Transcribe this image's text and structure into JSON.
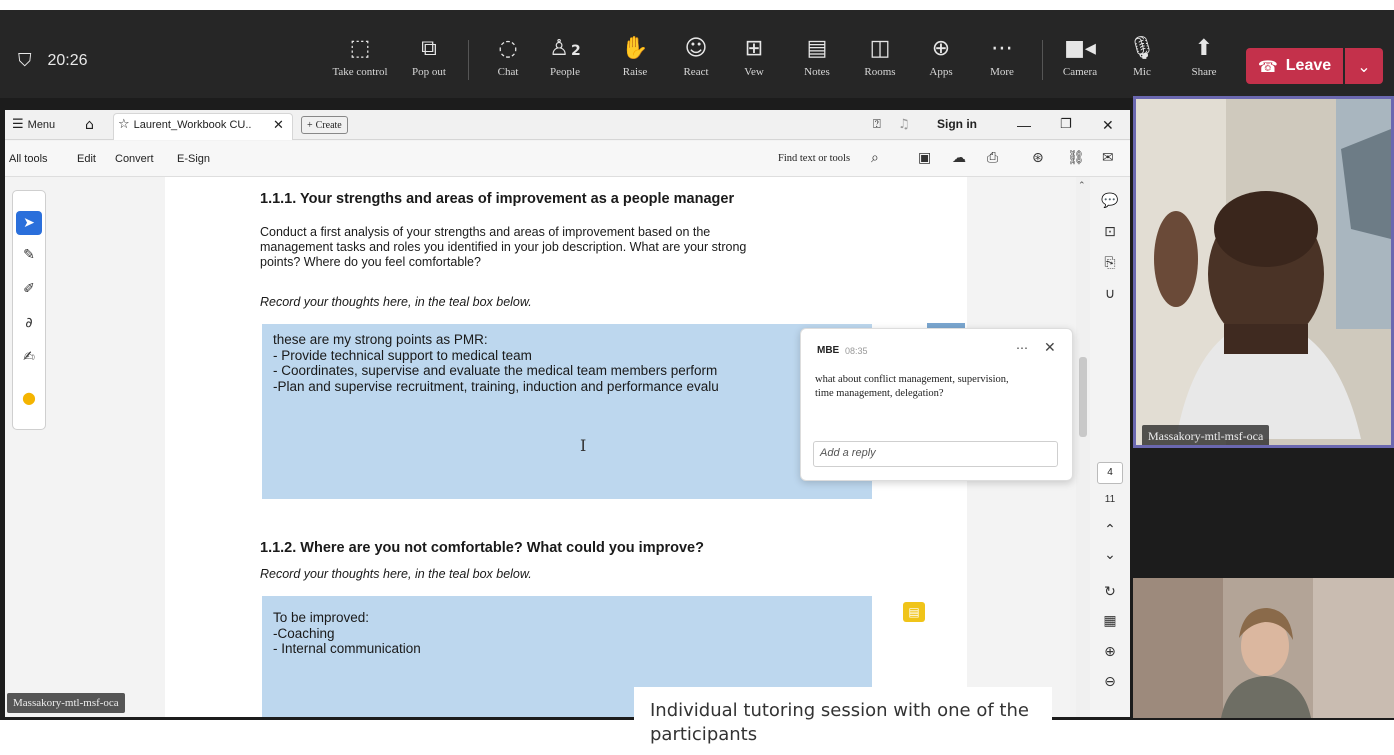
{
  "meeting": {
    "time": "20:26",
    "buttons": [
      {
        "label": "Take control",
        "icon": "take-control-icon"
      },
      {
        "label": "Pop out",
        "icon": "pop-out-icon"
      },
      {
        "label": "Chat",
        "icon": "chat-icon"
      },
      {
        "label": "People",
        "icon": "people-icon",
        "count": "2"
      },
      {
        "label": "Raise",
        "icon": "raise-hand-icon"
      },
      {
        "label": "React",
        "icon": "react-icon"
      },
      {
        "label": "Vew",
        "icon": "view-icon"
      },
      {
        "label": "Notes",
        "icon": "notes-icon"
      },
      {
        "label": "Rooms",
        "icon": "rooms-icon"
      },
      {
        "label": "Apps",
        "icon": "apps-icon"
      },
      {
        "label": "More",
        "icon": "more-icon"
      },
      {
        "label": "Camera",
        "icon": "camera-icon"
      },
      {
        "label": "Mic",
        "icon": "mic-icon"
      },
      {
        "label": "Share",
        "icon": "share-icon"
      }
    ],
    "leave_label": "Leave",
    "leave_color": "#c4314b"
  },
  "acrobat": {
    "menu_label": "Menu",
    "tab_title": "Laurent_Workbook CU..",
    "create_label": "Create",
    "sign_in": "Sign in",
    "tools": [
      "All tools",
      "Edit",
      "Convert",
      "E-Sign"
    ],
    "find_placeholder": "Find text or tools"
  },
  "document": {
    "h1": "1.1.1.  Your strengths and areas of improvement as a people manager",
    "p1_lines": [
      "Conduct a first analysis of your strengths and areas of improvement based on the",
      "management tasks and roles you identified in your job description. What are your strong",
      "points? Where do you feel comfortable?"
    ],
    "record1": "Record your thoughts here, in the teal box below.",
    "box1_lines": [
      "these are my strong points as PMR:",
      "- Provide technical support to medical team",
      "- Coordinates, supervise and evaluate the medical team members perform",
      "-Plan and supervise recruitment, training, induction and performance evalu"
    ],
    "h2": "1.1.2.  Where are you not comfortable? What could you improve?",
    "record2": "Record your thoughts here, in the teal box below.",
    "box2_lines": [
      "To be improved:",
      "-Coaching",
      "- Internal communication"
    ],
    "box_color": "#bdd7ee"
  },
  "comment": {
    "author": "MBE",
    "time": "08:35",
    "text_lines": [
      "what about conflict management, supervision,",
      "time management, delegation?"
    ],
    "reply_placeholder": "Add a reply",
    "note_color": "#f0c419"
  },
  "page_nav": {
    "current": "4",
    "total": "11"
  },
  "participants": {
    "name": "Massakory-mtl-msf-oca",
    "shared_name": "Massakory-mtl-msf-oca"
  },
  "caption": "Individual tutoring session with one of the participants"
}
